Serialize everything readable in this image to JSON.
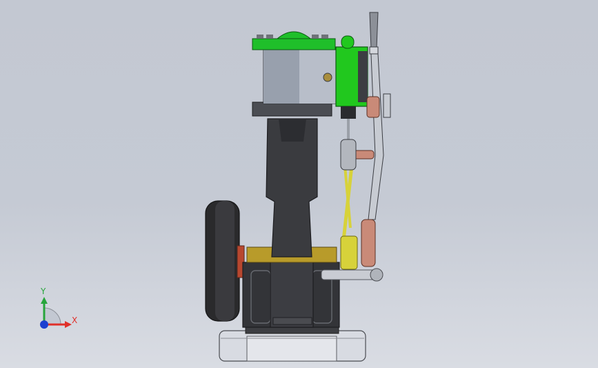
{
  "viewport": {
    "background_top": "#c3c8d2",
    "background_bottom": "#d9dce3"
  },
  "colors": {
    "flywheel": "#2b2b2d",
    "column": "#3a3b3f",
    "cylinder": "#a9b0bc",
    "cylinder_head": "#1fbf2a",
    "valve_chest": "#21c81e",
    "lever": "#c7cbd2",
    "copper_links": "#c98a78",
    "eccentric_rods": "#d7d23a",
    "brass_plate": "#b89b2a",
    "base": "#d9dce3"
  },
  "triad": {
    "x_label": "X",
    "y_label": "Y",
    "x_color": "#e0302a",
    "y_color": "#27a53b",
    "z_color": "#1d3fd0"
  }
}
